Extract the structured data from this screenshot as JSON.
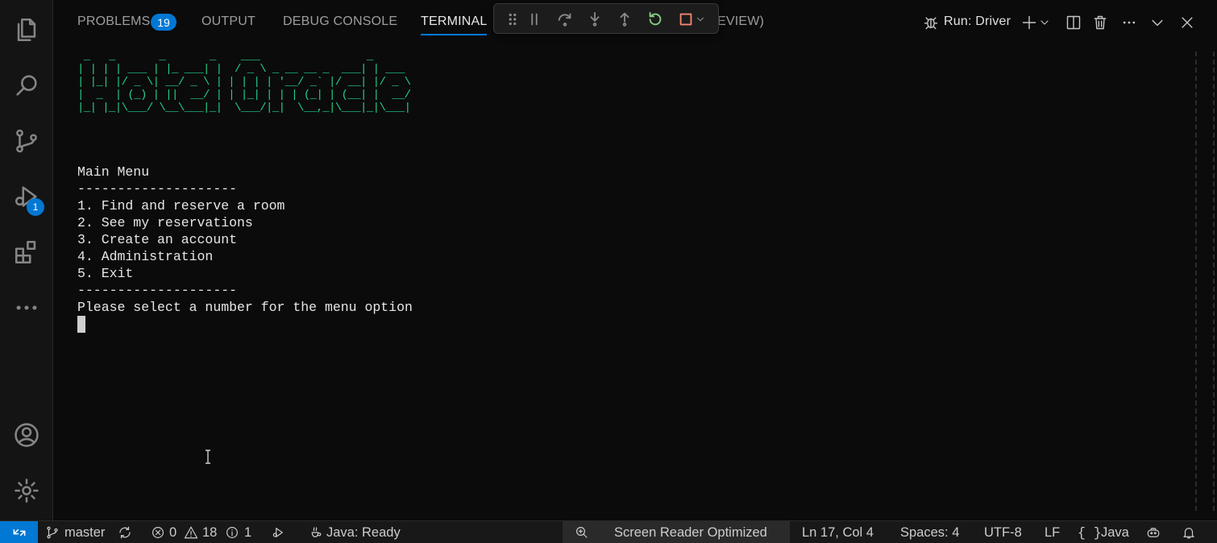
{
  "panel": {
    "tabs": [
      {
        "label": "PROBLEMS",
        "count": "19"
      },
      {
        "label": "OUTPUT"
      },
      {
        "label": "DEBUG CONSOLE"
      },
      {
        "label": "TERMINAL",
        "active": true
      },
      {
        "label_fragment": "EVIEW)"
      }
    ],
    "run_config": "Run: Driver"
  },
  "activity_bar": {
    "items": [
      "explorer-icon",
      "search-icon",
      "source-control-icon",
      "run-debug-icon",
      "extensions-icon",
      "more-icon",
      "account-icon",
      "gear-icon"
    ],
    "run_debug_badge": "1"
  },
  "debug_toolbar": {
    "buttons": [
      "drag-handle-icon",
      "pause-icon",
      "step-over-icon",
      "step-into-icon",
      "step-out-icon",
      "restart-icon",
      "stop-icon",
      "chevron-down-icon"
    ]
  },
  "terminal": {
    "banner": " _   _       _       _    ___                 _      \n| | | | ___ | |_ ___| |  / _ \\ _ __ __ _  ___| | ___ \n| |_| |/ _ \\| __/ _ \\ | | | | | '__/ _` |/ __| |/ _ \\\n|  _  | (_) | ||  __/ | | |_| | | | (_| | (__| |  __/\n|_| |_|\\___/ \\__\\___|_|  \\___/|_|  \\__,_|\\___|_|\\___|",
    "lines": [
      "Main Menu",
      "--------------------",
      "1. Find and reserve a room",
      "2. See my reservations",
      "3. Create an account",
      "4. Administration",
      "5. Exit",
      "--------------------",
      "Please select a number for the menu option"
    ]
  },
  "status_bar": {
    "branch": "master",
    "errors": "0",
    "warnings": "18",
    "infos": "1",
    "java_status": "Java: Ready",
    "screen_reader": "Screen Reader Optimized",
    "cursor_position": "Ln 17, Col 4",
    "indentation": "Spaces: 4",
    "encoding": "UTF-8",
    "eol": "LF",
    "language": "Java",
    "accent_color": "#0078d4"
  }
}
